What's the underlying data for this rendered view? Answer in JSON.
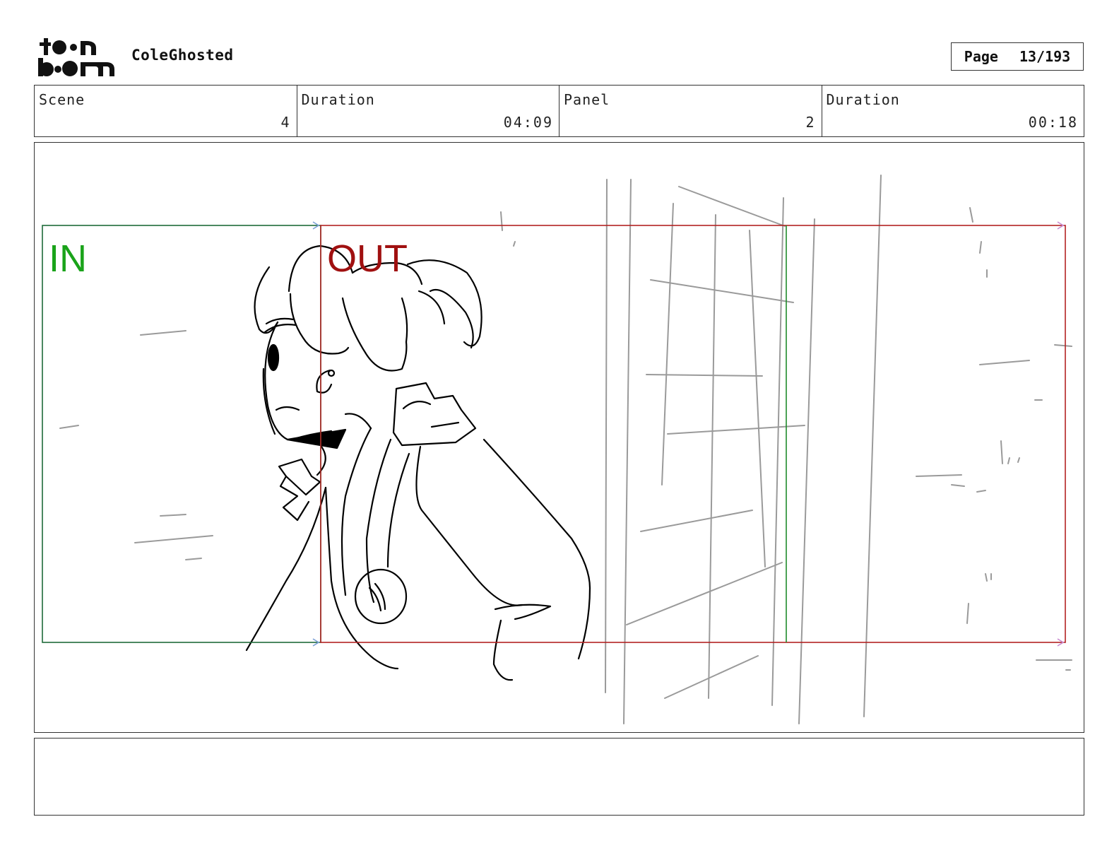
{
  "header": {
    "logo_text": "toon boom",
    "project_title": "ColeGhosted",
    "page_label": "Page",
    "page_number": "13/193"
  },
  "info": {
    "scene_label": "Scene",
    "scene_value": "4",
    "scene_duration_label": "Duration",
    "scene_duration_value": "04:09",
    "panel_label": "Panel",
    "panel_value": "2",
    "panel_duration_label": "Duration",
    "panel_duration_value": "00:18"
  },
  "panel": {
    "in_label": "IN",
    "out_label": "OUT",
    "colors": {
      "in_frame": "#1f6b3a",
      "out_frame": "#b22222",
      "in_text": "#1aa31a",
      "out_text": "#a01010",
      "sketch": "#000000",
      "background_sketch": "#9a9a9a"
    }
  },
  "notes": {
    "text": ""
  }
}
